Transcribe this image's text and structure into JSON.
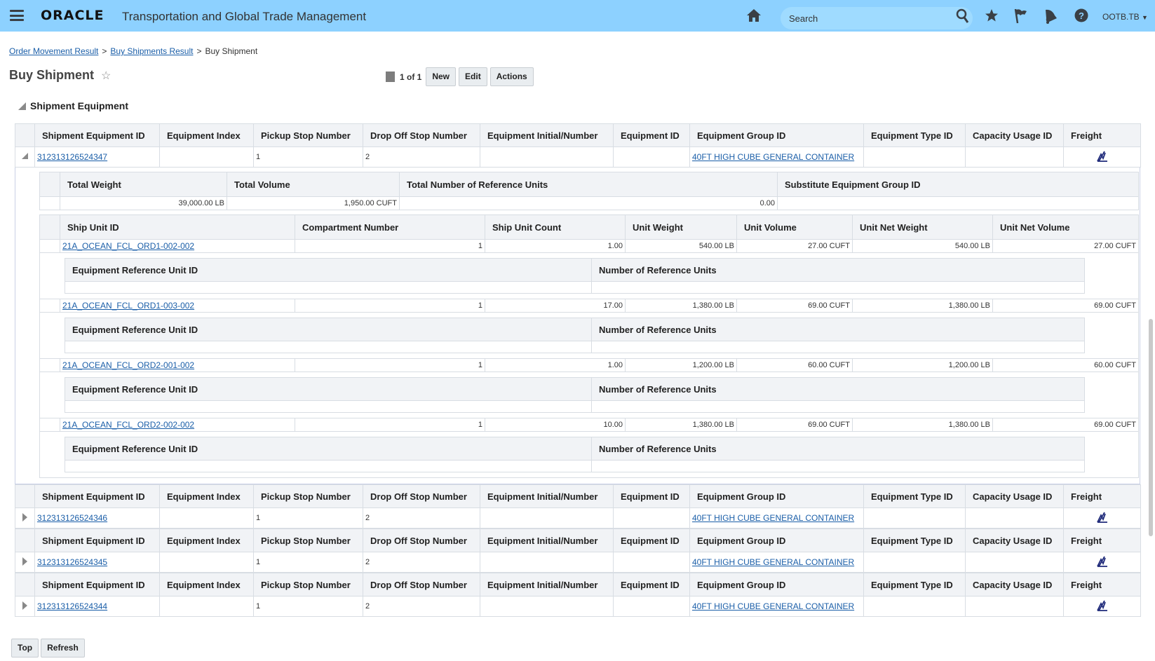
{
  "header": {
    "brand": "ORACLE",
    "app_title": "Transportation and Global Trade Management",
    "search_placeholder": "Search",
    "user": "OOTB.TB"
  },
  "breadcrumb": [
    "Order Movement Result",
    "Buy Shipments Result",
    "Buy Shipment"
  ],
  "page": {
    "title": "Buy Shipment",
    "pager": "1 of 1",
    "buttons": {
      "new": "New",
      "edit": "Edit",
      "actions": "Actions"
    }
  },
  "section": {
    "title": "Shipment Equipment"
  },
  "equipment_columns": [
    "Shipment Equipment ID",
    "Equipment Index",
    "Pickup Stop Number",
    "Drop Off Stop Number",
    "Equipment Initial/Number",
    "Equipment ID",
    "Equipment Group ID",
    "Equipment Type ID",
    "Capacity Usage ID",
    "Freight"
  ],
  "equipment": [
    {
      "id": "312313126524347",
      "index": "",
      "pickup": "1",
      "dropoff": "2",
      "initial": "",
      "equip_id": "",
      "group": "40FT HIGH CUBE GENERAL CONTAINER",
      "type": "",
      "capacity": "",
      "expanded": true
    },
    {
      "id": "312313126524346",
      "index": "",
      "pickup": "1",
      "dropoff": "2",
      "initial": "",
      "equip_id": "",
      "group": "40FT HIGH CUBE GENERAL CONTAINER",
      "type": "",
      "capacity": "",
      "expanded": false
    },
    {
      "id": "312313126524345",
      "index": "",
      "pickup": "1",
      "dropoff": "2",
      "initial": "",
      "equip_id": "",
      "group": "40FT HIGH CUBE GENERAL CONTAINER",
      "type": "",
      "capacity": "",
      "expanded": false
    },
    {
      "id": "312313126524344",
      "index": "",
      "pickup": "1",
      "dropoff": "2",
      "initial": "",
      "equip_id": "",
      "group": "40FT HIGH CUBE GENERAL CONTAINER",
      "type": "",
      "capacity": "",
      "expanded": false
    }
  ],
  "totals": {
    "columns": [
      "Total Weight",
      "Total Volume",
      "Total Number of Reference Units",
      "Substitute Equipment Group ID"
    ],
    "values": [
      "39,000.00 LB",
      "1,950.00 CUFT",
      "0.00",
      ""
    ]
  },
  "ship_unit_columns": [
    "Ship Unit ID",
    "Compartment Number",
    "Ship Unit Count",
    "Unit Weight",
    "Unit Volume",
    "Unit Net Weight",
    "Unit Net Volume"
  ],
  "ref_columns": [
    "Equipment Reference Unit ID",
    "Number of Reference Units"
  ],
  "ship_units": [
    [
      "21A_OCEAN_FCL_ORD1-002-002",
      "1",
      "1.00",
      "540.00 LB",
      "27.00 CUFT",
      "540.00 LB",
      "27.00 CUFT"
    ],
    [
      "21A_OCEAN_FCL_ORD1-003-002",
      "1",
      "17.00",
      "1,380.00 LB",
      "69.00 CUFT",
      "1,380.00 LB",
      "69.00 CUFT"
    ],
    [
      "21A_OCEAN_FCL_ORD2-001-002",
      "1",
      "1.00",
      "1,200.00 LB",
      "60.00 CUFT",
      "1,200.00 LB",
      "60.00 CUFT"
    ],
    [
      "21A_OCEAN_FCL_ORD2-002-002",
      "1",
      "10.00",
      "1,380.00 LB",
      "69.00 CUFT",
      "1,380.00 LB",
      "69.00 CUFT"
    ]
  ],
  "footer": {
    "top": "Top",
    "refresh": "Refresh"
  }
}
